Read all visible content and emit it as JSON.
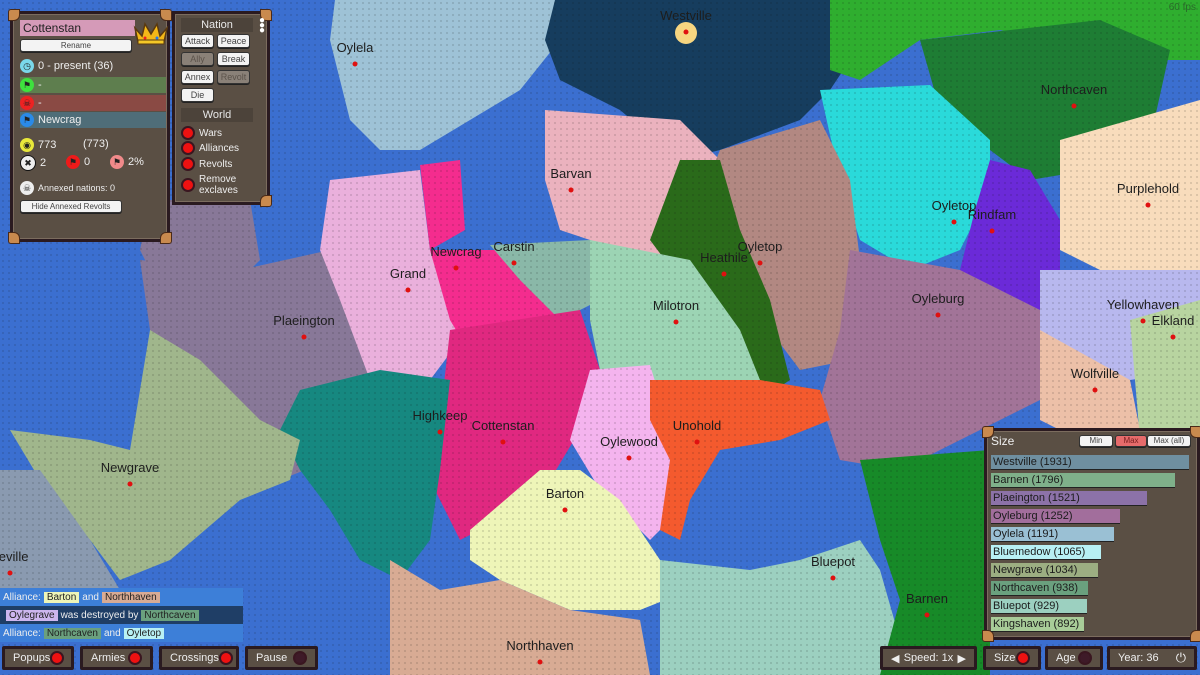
{
  "fps": "60 fps",
  "nation": {
    "name": "Cottenstan",
    "rename_label": "Rename",
    "age_text": "0 - present (36)",
    "ally_text": "-",
    "enemy_text": "-",
    "origin_text": "Newcrag",
    "size_text": "773",
    "max_size_text": "(773)",
    "wars_count": "2",
    "revolts_count": "0",
    "revolt_chance": "2%",
    "annexed_text": "Annexed nations: 0",
    "hide_revolts_label": "Hide Annexed Revolts",
    "colors": {
      "name_bg": "#d59ab8",
      "ally_bar": "#5e7e4e",
      "enemy_bar": "#8a4a44",
      "origin_bar": "#4f6d78"
    }
  },
  "actions": {
    "nation_title": "Nation",
    "buttons": [
      {
        "label": "Attack",
        "enabled": true
      },
      {
        "label": "Peace",
        "enabled": true
      },
      {
        "label": "Ally",
        "enabled": false
      },
      {
        "label": "Break",
        "enabled": true
      },
      {
        "label": "Annex",
        "enabled": true
      },
      {
        "label": "Revolt",
        "enabled": false
      },
      {
        "label": "Die",
        "enabled": true
      }
    ],
    "world_title": "World",
    "toggles": [
      {
        "label": "Wars",
        "on": true
      },
      {
        "label": "Alliances",
        "on": true
      },
      {
        "label": "Revolts",
        "on": true
      },
      {
        "label": "Remove",
        "label2": "exclaves",
        "on": true
      }
    ]
  },
  "ranking": {
    "title": "Size",
    "buttons": [
      {
        "label": "Min",
        "active": false
      },
      {
        "label": "Max",
        "active": true
      },
      {
        "label": "Max (all)",
        "active": false
      }
    ],
    "items": [
      {
        "label": "Westville (1931)",
        "value": 1931,
        "color": "#6f8fa0"
      },
      {
        "label": "Barnen (1796)",
        "value": 1796,
        "color": "#7fb08a"
      },
      {
        "label": "Plaeington (1521)",
        "value": 1521,
        "color": "#8c72a8"
      },
      {
        "label": "Oyleburg (1252)",
        "value": 1252,
        "color": "#a26e9c"
      },
      {
        "label": "Oylela (1191)",
        "value": 1191,
        "color": "#9ac0d4"
      },
      {
        "label": "Bluemedow (1065)",
        "value": 1065,
        "color": "#b8f0f4"
      },
      {
        "label": "Newgrave (1034)",
        "value": 1034,
        "color": "#9cae82"
      },
      {
        "label": "Northcaven (938)",
        "value": 938,
        "color": "#6aa07e"
      },
      {
        "label": "Bluepot (929)",
        "value": 929,
        "color": "#9cd0c0"
      },
      {
        "label": "Kingshaven (892)",
        "value": 892,
        "color": "#a8cc98"
      }
    ]
  },
  "log": [
    {
      "prefix": "Alliance:",
      "a": "Barton",
      "a_color": "#eef5b8",
      "mid": "and",
      "b": "Northhaven",
      "b_color": "#d8ab94",
      "bg": "#3d7fd8"
    },
    {
      "prefix": "",
      "a": "Oylegrave",
      "a_color": "#cdb6ee",
      "mid": "was destroyed by",
      "b": "Northcaven",
      "b_color": "#6aa07e",
      "bg": "#1f3e66"
    },
    {
      "prefix": "Alliance:",
      "a": "Northcaven",
      "a_color": "#6aa07e",
      "mid": "and",
      "b": "Oyletop",
      "b_color": "#b8f0f4",
      "bg": "#3d7fd8"
    }
  ],
  "bottom_bar": {
    "popups": {
      "label": "Popups",
      "on": true
    },
    "armies": {
      "label": "Armies",
      "on": true
    },
    "crossings": {
      "label": "Crossings",
      "on": true
    },
    "pause": {
      "label": "Pause",
      "on": false
    },
    "speed": "Speed: 1x",
    "size": {
      "label": "Size",
      "on": true
    },
    "age": {
      "label": "Age",
      "on": false
    },
    "year": "Year: 36"
  },
  "cities": [
    {
      "name": "Westville"
    },
    {
      "name": "Oylela"
    },
    {
      "name": "Northcaven"
    },
    {
      "name": "Purplehold"
    },
    {
      "name": "Oyletop"
    },
    {
      "name": "Rindfam"
    },
    {
      "name": "Barvan"
    },
    {
      "name": "Grand"
    },
    {
      "name": "Newcrag"
    },
    {
      "name": "Carstin"
    },
    {
      "name": "Heathile"
    },
    {
      "name": "Oyletop"
    },
    {
      "name": "Plaeington"
    },
    {
      "name": "Milotron"
    },
    {
      "name": "Oyleburg"
    },
    {
      "name": "Yellowhaven"
    },
    {
      "name": "Elkland"
    },
    {
      "name": "Wolfville"
    },
    {
      "name": "Highkeep"
    },
    {
      "name": "Cottenstan"
    },
    {
      "name": "Oylewood"
    },
    {
      "name": "Unohold"
    },
    {
      "name": "Newgrave"
    },
    {
      "name": "Barton"
    },
    {
      "name": "Bluepot"
    },
    {
      "name": "Barnen"
    },
    {
      "name": "Northhaven"
    },
    {
      "name": "aeville"
    }
  ]
}
